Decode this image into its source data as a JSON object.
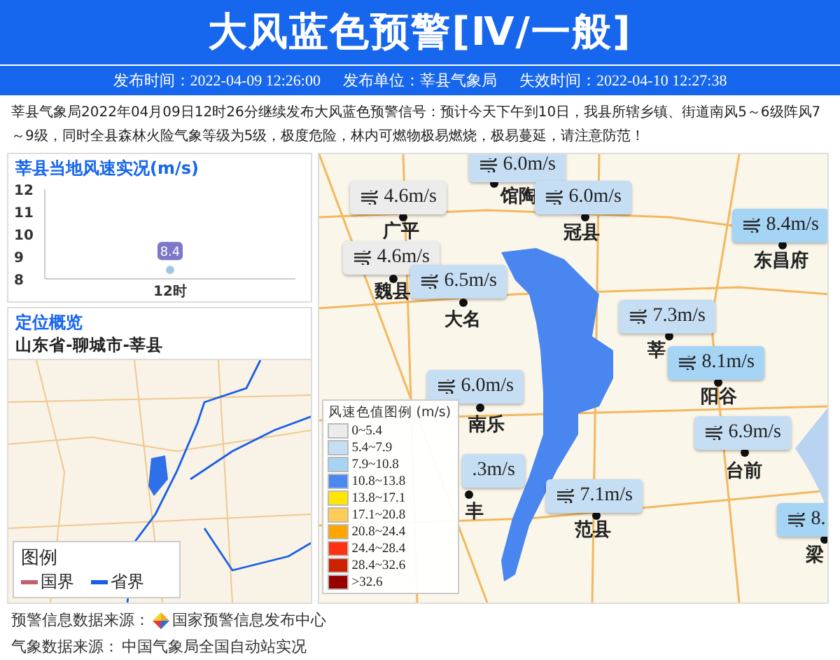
{
  "header": {
    "title": "大风蓝色预警[Ⅳ/一般]",
    "meta": [
      "发布时间：2022-04-09 12:26:00",
      "发布单位：莘县气象局",
      "失效时间：2022-04-10 12:27:38"
    ]
  },
  "description": "莘县气象局2022年04月09日12时26分继续发布大风蓝色预警信号：预计今天下午到10日，我县所辖乡镇、街道南风5～6级阵风7～9级，同时全县森林火险气象等级为5级，极度危险，林内可燃物极易燃烧，极易蔓延，请注意防范！",
  "wind_panel": {
    "title": "莘县当地风速实况(m/s)",
    "chart_data": {
      "type": "line",
      "categories": [
        "12时"
      ],
      "series": [
        {
          "color": "#9ecae1",
          "marker": "circle",
          "values": [
            8.4
          ]
        }
      ],
      "ylim": [
        8,
        12
      ],
      "yticks": [
        8,
        9,
        10,
        11,
        12
      ],
      "data_labels": true
    }
  },
  "location_panel": {
    "title": "定位概览",
    "path": "山东省-聊城市-莘县",
    "legend": {
      "title": "图例",
      "items": [
        {
          "label": "国界",
          "color": "#c06070"
        },
        {
          "label": "省界",
          "color": "#1a5ee8"
        }
      ]
    }
  },
  "map": {
    "cities": [
      {
        "name": "广平"
      },
      {
        "name": "馆陶"
      },
      {
        "name": "冠县"
      },
      {
        "name": "东昌府"
      },
      {
        "name": "魏县"
      },
      {
        "name": "大名"
      },
      {
        "name": "莘"
      },
      {
        "name": "阳谷"
      },
      {
        "name": "南乐"
      },
      {
        "name": "台前"
      },
      {
        "name": "丰"
      },
      {
        "name": "范县"
      },
      {
        "name": "梁"
      }
    ],
    "markers": [
      {
        "reading": "6.0m/s",
        "color": "#c6def3"
      },
      {
        "reading": "4.6m/s",
        "color": "#ececec"
      },
      {
        "reading": "6.0m/s",
        "color": "#c6def3"
      },
      {
        "reading": "8.4m/s",
        "color": "#a6d4f5"
      },
      {
        "reading": "4.6m/s",
        "color": "#ececec"
      },
      {
        "reading": "6.5m/s",
        "color": "#c6def3"
      },
      {
        "reading": "7.3m/s",
        "color": "#c6def3"
      },
      {
        "reading": "8.1m/s",
        "color": "#a6d4f5"
      },
      {
        "reading": "6.0m/s",
        "color": "#c6def3"
      },
      {
        "reading": "6.9m/s",
        "color": "#c6def3"
      },
      {
        "reading": ".3m/s",
        "color": "#c6def3"
      },
      {
        "reading": "7.1m/s",
        "color": "#c6def3"
      },
      {
        "reading": "8.",
        "color": "#a6d4f5"
      }
    ],
    "legend": {
      "title": "风速色值图例 (m/s)",
      "items": [
        {
          "label": "0~5.4",
          "color": "#ececec"
        },
        {
          "label": "5.4~7.9",
          "color": "#c6def3"
        },
        {
          "label": "7.9~10.8",
          "color": "#a6d4f5"
        },
        {
          "label": "10.8~13.8",
          "color": "#4a8af0"
        },
        {
          "label": "13.8~17.1",
          "color": "#ffe600"
        },
        {
          "label": "17.1~20.8",
          "color": "#ffcc55"
        },
        {
          "label": "20.8~24.4",
          "color": "#ffa500"
        },
        {
          "label": "24.4~28.4",
          "color": "#ff3311"
        },
        {
          "label": "28.4~32.6",
          "color": "#cc2200"
        },
        {
          "label": ">32.6",
          "color": "#990000"
        }
      ]
    }
  },
  "footer": [
    {
      "label": "预警信息数据来源：",
      "source": "国家预警信息发布中心",
      "kind": "logo"
    },
    {
      "label": "气象数据来源：",
      "source": "中国气象局全国自动站实况",
      "kind": "plain"
    }
  ]
}
